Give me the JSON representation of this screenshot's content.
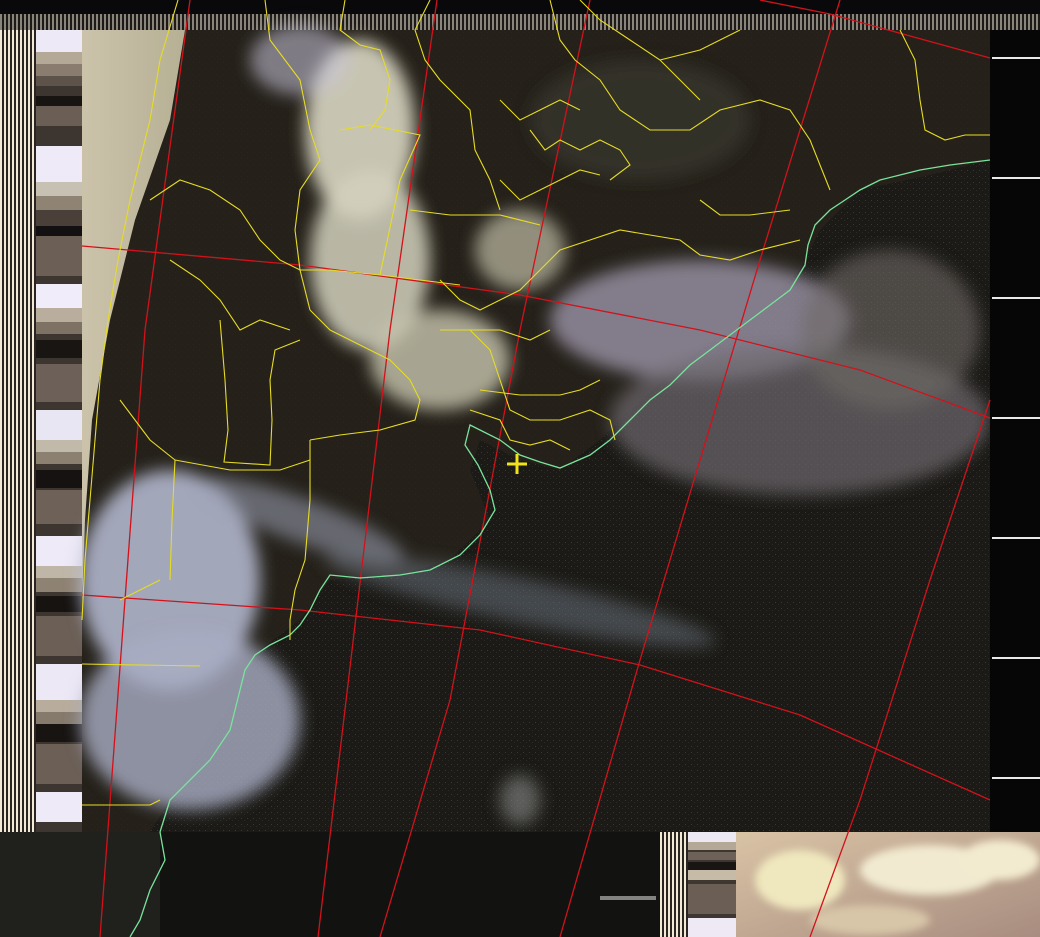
{
  "image": {
    "kind": "satellite-weather-image",
    "colors": {
      "land_dark": "#24211a",
      "ocean": "#111110",
      "cloud_white": "#d8d6c6",
      "cloud_lilac": "#9a92a8",
      "cloud_blue": "#b9bfd6",
      "telemetry_cream": "#f3ead8",
      "false_color_pink": "#b79a88",
      "border_lines": "#e8e02a",
      "coastline": "#7be39a",
      "graticule": "#d8141c"
    },
    "marker": {
      "icon": "crosshair-plus-icon",
      "color": "#f2e21c"
    }
  }
}
